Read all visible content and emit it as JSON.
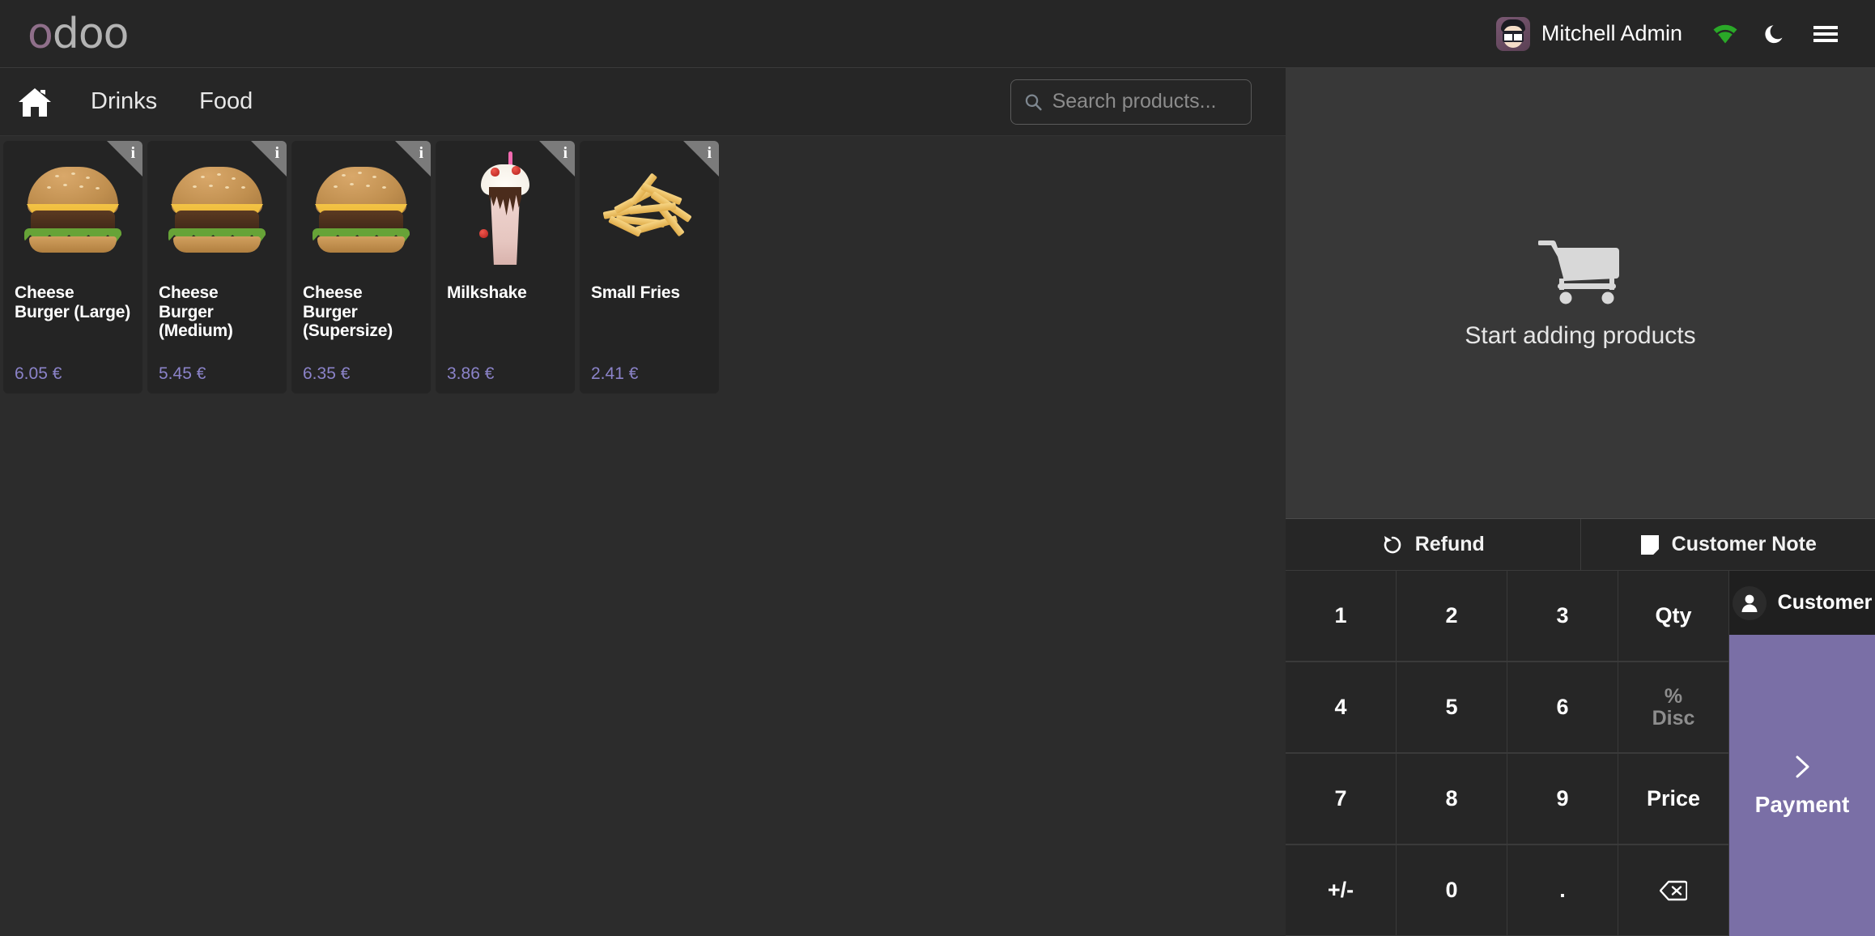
{
  "navbar": {
    "brand_first_letter": "o",
    "brand_rest": "doo",
    "username": "Mitchell Admin",
    "icons": {
      "avatar": "avatar",
      "wifi": "wifi-icon",
      "darkmode": "moon-icon",
      "menu": "hamburger-menu-icon"
    },
    "accent_green": "#2aa828"
  },
  "product_header": {
    "home_icon": "home-icon",
    "categories": [
      {
        "label": "Drinks"
      },
      {
        "label": "Food"
      }
    ],
    "search": {
      "placeholder": "Search products...",
      "value": "",
      "icon": "search-icon"
    }
  },
  "products": [
    {
      "name": "Cheese Burger (Large)",
      "price": "6.05 €",
      "image": "cheese-burger",
      "info_badge": "i"
    },
    {
      "name": "Cheese Burger (Medium)",
      "price": "5.45 €",
      "image": "cheese-burger",
      "info_badge": "i"
    },
    {
      "name": "Cheese Burger (Supersize)",
      "price": "6.35 €",
      "image": "cheese-burger",
      "info_badge": "i"
    },
    {
      "name": "Milkshake",
      "price": "3.86 €",
      "image": "milkshake",
      "info_badge": "i"
    },
    {
      "name": "Small Fries",
      "price": "2.41 €",
      "image": "fries",
      "info_badge": "i"
    }
  ],
  "cart": {
    "empty_icon": "shopping-cart-icon",
    "empty_text": "Start adding products"
  },
  "actions": [
    {
      "label": "Refund",
      "icon": "refund-icon"
    },
    {
      "label": "Customer Note",
      "icon": "note-icon"
    }
  ],
  "numpad": {
    "keys": [
      {
        "label": "1",
        "muted": false
      },
      {
        "label": "2",
        "muted": false
      },
      {
        "label": "3",
        "muted": false
      },
      {
        "label": "Qty",
        "muted": false
      },
      {
        "label": "4",
        "muted": false
      },
      {
        "label": "5",
        "muted": false
      },
      {
        "label": "6",
        "muted": false
      },
      {
        "label": "%",
        "sub": "Disc",
        "muted": true
      },
      {
        "label": "7",
        "muted": false
      },
      {
        "label": "8",
        "muted": false
      },
      {
        "label": "9",
        "muted": false
      },
      {
        "label": "Price",
        "muted": false
      },
      {
        "label": "+/-",
        "muted": false
      },
      {
        "label": "0",
        "muted": false
      },
      {
        "label": ".",
        "muted": false
      },
      {
        "label": "",
        "icon": "backspace-icon",
        "muted": false
      }
    ]
  },
  "side_actions": {
    "customer_label": "Customer",
    "customer_icon": "person-icon",
    "payment_label": "Payment",
    "payment_icon": "chevron-right-icon",
    "payment_color": "#7a6fa6"
  },
  "colors": {
    "page_bg": "#2c2c2c",
    "panel_bg": "#383838",
    "bar_bg": "#262626",
    "card_bg": "#242424",
    "price_text": "#8b83c9",
    "brand_purple": "#8f6f8a"
  }
}
